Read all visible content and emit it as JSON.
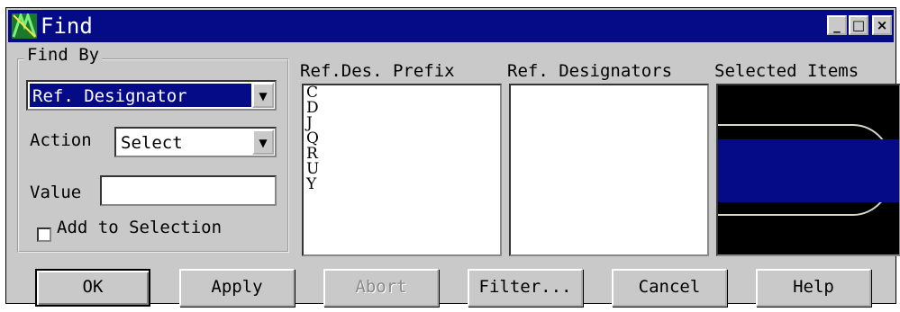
{
  "window": {
    "title": "Find",
    "minimize_glyph": "_",
    "maximize_glyph": "□",
    "close_glyph": "×"
  },
  "find_by": {
    "group_label": "Find By",
    "type_value": "Ref. Designator",
    "action_label": "Action",
    "action_value": "Select",
    "value_label": "Value",
    "value_text": "",
    "add_to_selection_label": "Add to Selection",
    "add_to_selection_checked": false
  },
  "columns": {
    "prefix_header": "Ref.Des. Prefix",
    "designators_header": "Ref. Designators",
    "selected_header": "Selected Items"
  },
  "prefix_list": [
    "C",
    "D",
    "J",
    "Q",
    "R",
    "U",
    "Y"
  ],
  "buttons": {
    "ok": "OK",
    "apply": "Apply",
    "abort": "Abort",
    "filter": "Filter...",
    "cancel": "Cancel",
    "help": "Help"
  },
  "colors": {
    "titlebar": "#050a86",
    "selection": "#050a86",
    "preview_bg": "#000000",
    "preview_shape": "#050a86"
  },
  "icons": {
    "app": "app-icon",
    "dropdown": "chevron-down-icon"
  }
}
